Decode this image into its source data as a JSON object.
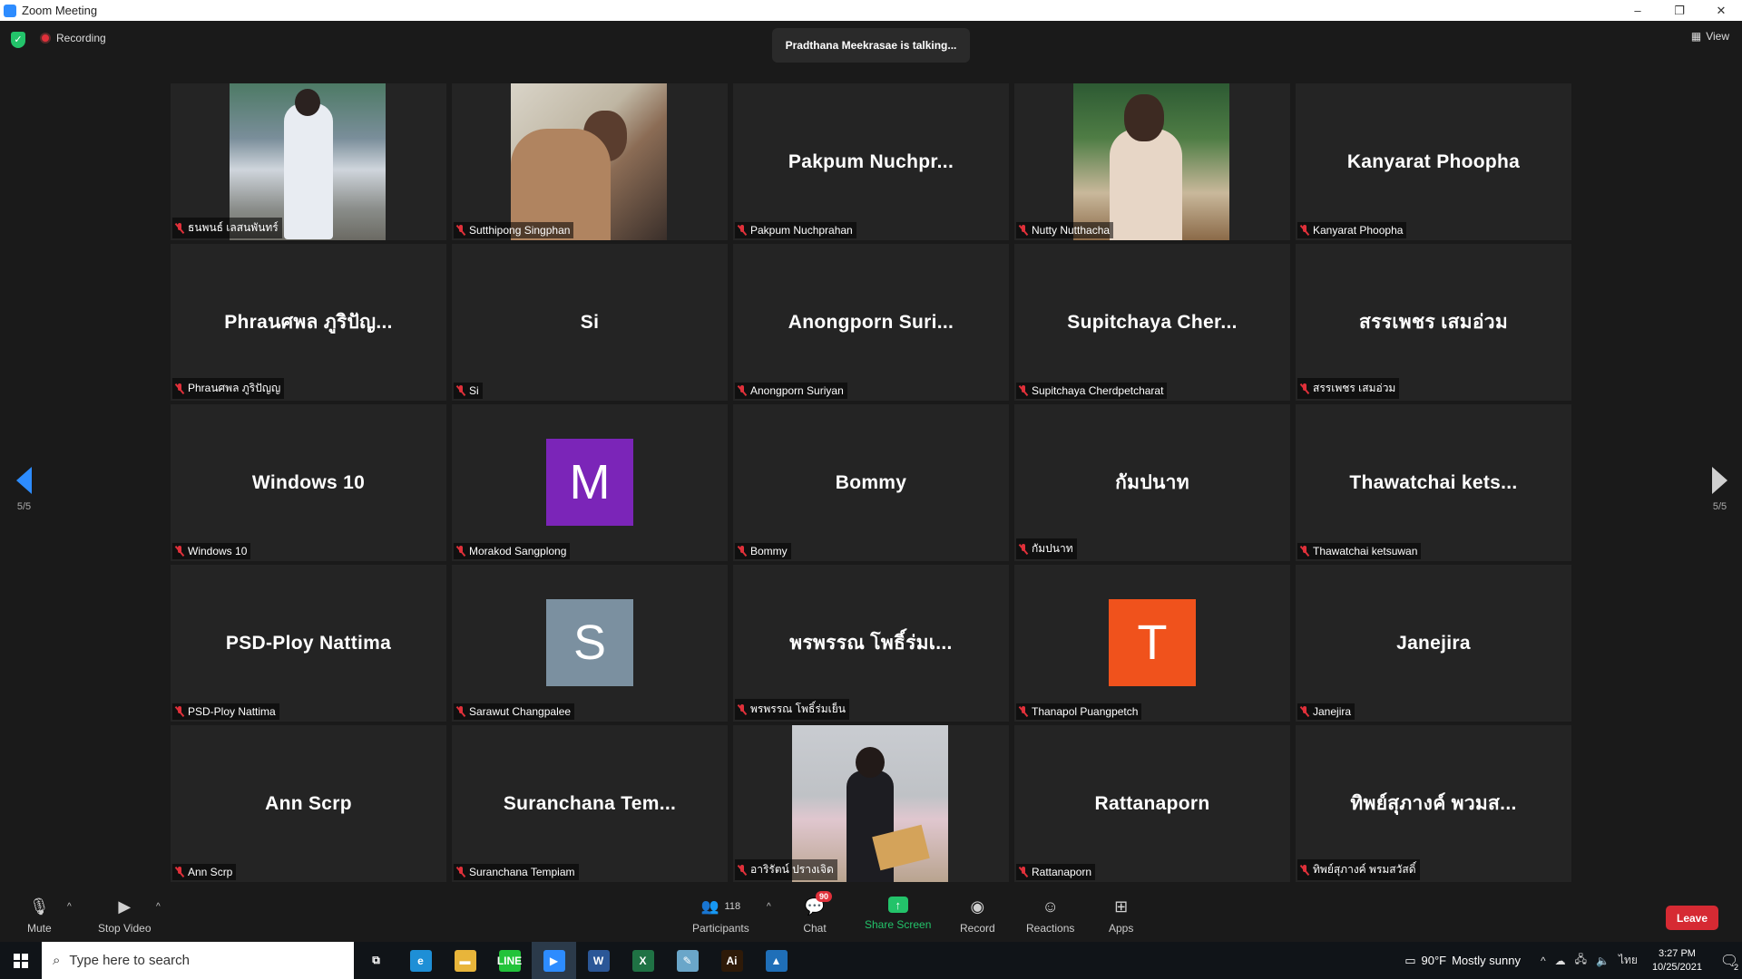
{
  "window": {
    "title": "Zoom Meeting",
    "minimize": "–",
    "restore": "❐",
    "close": "✕"
  },
  "header": {
    "recording": "Recording",
    "talking": "Pradthana Meekrasae is talking...",
    "view": "View"
  },
  "nav": {
    "page_left": "5/5",
    "page_right": "5/5"
  },
  "tiles": [
    {
      "label": "ธนพนธ์ เลสนพันทร์",
      "big": "",
      "type": "photo",
      "photo": 1
    },
    {
      "label": "Sutthipong Singphan",
      "big": "",
      "type": "photo",
      "photo": 2
    },
    {
      "label": "Pakpum Nuchprahan",
      "big": "Pakpum  Nuchpr...",
      "type": "name"
    },
    {
      "label": "Nutty Nutthacha",
      "big": "",
      "type": "photo",
      "photo": 4
    },
    {
      "label": "Kanyarat Phoopha",
      "big": "Kanyarat Phoopha",
      "type": "name"
    },
    {
      "label": "Phraนศพล ภูริปัญญ",
      "big": "Phraนศพล ภูริปัญ...",
      "type": "name"
    },
    {
      "label": "Si",
      "big": "Si",
      "type": "name"
    },
    {
      "label": "Anongporn Suriyan",
      "big": "Anongporn  Suri...",
      "type": "name"
    },
    {
      "label": "Supitchaya Cherdpetcharat",
      "big": "Supitchaya  Cher...",
      "type": "name"
    },
    {
      "label": "สรรเพชร เสมอ่วม",
      "big": "สรรเพชร เสมอ่วม",
      "type": "name"
    },
    {
      "label": "Windows 10",
      "big": "Windows 10",
      "type": "name"
    },
    {
      "label": "Morakod Sangplong",
      "big": "",
      "type": "avatar",
      "letter": "M",
      "color": "#7b25b8"
    },
    {
      "label": "Bommy",
      "big": "Bommy",
      "type": "name"
    },
    {
      "label": "กัมปนาท",
      "big": "กัมปนาท",
      "type": "name"
    },
    {
      "label": "Thawatchai ketsuwan",
      "big": "Thawatchai  kets...",
      "type": "name"
    },
    {
      "label": "PSD-Ploy Nattima",
      "big": "PSD-Ploy Nattima",
      "type": "name"
    },
    {
      "label": "Sarawut Changpalee",
      "big": "",
      "type": "avatar",
      "letter": "S",
      "color": "#7b90a0"
    },
    {
      "label": "พรพรรณ โพธิ์ร่มเย็น",
      "big": "พรพรรณ  โพธิ์ร่มเ...",
      "type": "name"
    },
    {
      "label": "Thanapol Puangpetch",
      "big": "",
      "type": "avatar",
      "letter": "T",
      "color": "#f0521c"
    },
    {
      "label": "Janejira",
      "big": "Janejira",
      "type": "name"
    },
    {
      "label": "Ann Scrp",
      "big": "Ann Scrp",
      "type": "name"
    },
    {
      "label": "Suranchana Tempiam",
      "big": "Suranchana  Tem...",
      "type": "name"
    },
    {
      "label": "อาริรัตน์ ปรางเจิด",
      "big": "",
      "type": "photo",
      "photo": 23
    },
    {
      "label": "Rattanaporn",
      "big": "Rattanaporn",
      "type": "name"
    },
    {
      "label": "ทิพย์สุภางค์ พรมสวัสดิ์",
      "big": "ทิพย์สุภางค์  พวมส...",
      "type": "name"
    }
  ],
  "toolbar": {
    "mute": "Mute",
    "stop_video": "Stop Video",
    "participants": "Participants",
    "participants_count": "118",
    "chat": "Chat",
    "chat_badge": "90",
    "share": "Share Screen",
    "record": "Record",
    "reactions": "Reactions",
    "apps": "Apps",
    "leave": "Leave"
  },
  "taskbar": {
    "search_placeholder": "Type here to search",
    "weather_temp": "90°F",
    "weather_desc": "Mostly sunny",
    "lang": "ไทย",
    "time": "3:27 PM",
    "date": "10/25/2021",
    "notif_count": "2",
    "apps": [
      {
        "name": "task-view",
        "label": "⧉",
        "color": "#101418"
      },
      {
        "name": "edge",
        "label": "e",
        "color": "#1e8fd6"
      },
      {
        "name": "file-explorer",
        "label": "▬",
        "color": "#e8b53a"
      },
      {
        "name": "line",
        "label": "LINE",
        "color": "#22c33a"
      },
      {
        "name": "zoom",
        "label": "▶",
        "color": "#2d8cff"
      },
      {
        "name": "word",
        "label": "W",
        "color": "#2b5797"
      },
      {
        "name": "excel",
        "label": "X",
        "color": "#1f7244"
      },
      {
        "name": "notepad",
        "label": "✎",
        "color": "#6aa6c9"
      },
      {
        "name": "illustrator",
        "label": "Ai",
        "color": "#2e1a08"
      },
      {
        "name": "photos",
        "label": "▲",
        "color": "#1f6fb8"
      }
    ]
  }
}
